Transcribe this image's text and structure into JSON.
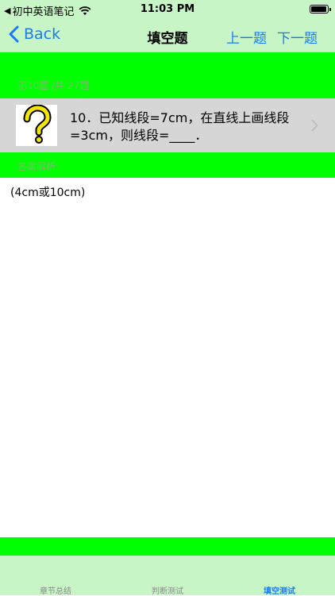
{
  "status_bar": {
    "back_app": "◀",
    "app_name": "初中英语笔记",
    "time": "11:03 PM"
  },
  "nav": {
    "back_label": "Back",
    "title": "填空题",
    "prev_label": "上一题",
    "next_label": "下一题",
    "accent_color": "#1a7cf5"
  },
  "question": {
    "progress": "第10题 /共 27题",
    "text": "10．已知线段=7cm，在直线上画线段=3cm，则线段=____．",
    "icon": "question-mark-icon"
  },
  "answer": {
    "label": "答案解析:",
    "text": "(4cm或10cm)"
  },
  "tabs": [
    {
      "label": "章节总结",
      "active": false
    },
    {
      "label": "判断测试",
      "active": false
    },
    {
      "label": "填空测试",
      "active": true
    }
  ],
  "colors": {
    "band_green": "#00ff00",
    "bar_green": "#c8f5c6",
    "row_gray": "#d6d6d6"
  }
}
